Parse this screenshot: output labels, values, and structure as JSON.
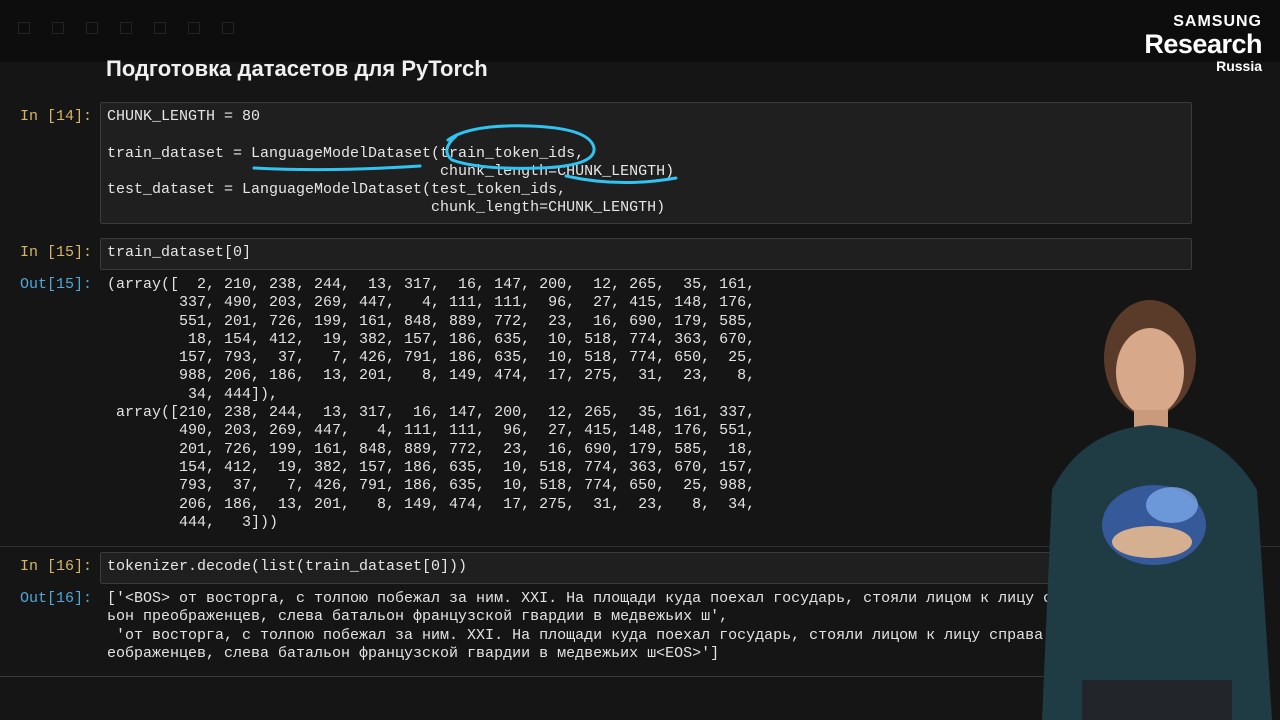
{
  "brand": {
    "line1": "SAMSUNG",
    "line2": "Research",
    "line3": "Russia"
  },
  "heading": "Подготовка датасетов для PyTorch",
  "cells": {
    "in14": {
      "prompt": "In [14]:",
      "code": "CHUNK_LENGTH = 80\n\ntrain_dataset = LanguageModelDataset(train_token_ids,\n                                     chunk_length=CHUNK_LENGTH)\ntest_dataset = LanguageModelDataset(test_token_ids,\n                                    chunk_length=CHUNK_LENGTH)"
    },
    "in15": {
      "prompt": "In [15]:",
      "code": "train_dataset[0]"
    },
    "out15": {
      "prompt": "Out[15]:",
      "text": "(array([  2, 210, 238, 244,  13, 317,  16, 147, 200,  12, 265,  35, 161,\n        337, 490, 203, 269, 447,   4, 111, 111,  96,  27, 415, 148, 176,\n        551, 201, 726, 199, 161, 848, 889, 772,  23,  16, 690, 179, 585,\n         18, 154, 412,  19, 382, 157, 186, 635,  10, 518, 774, 363, 670,\n        157, 793,  37,   7, 426, 791, 186, 635,  10, 518, 774, 650,  25,\n        988, 206, 186,  13, 201,   8, 149, 474,  17, 275,  31,  23,   8,\n         34, 444]),\n array([210, 238, 244,  13, 317,  16, 147, 200,  12, 265,  35, 161, 337,\n        490, 203, 269, 447,   4, 111, 111,  96,  27, 415, 148, 176, 551,\n        201, 726, 199, 161, 848, 889, 772,  23,  16, 690, 179, 585,  18,\n        154, 412,  19, 382, 157, 186, 635,  10, 518, 774, 363, 670, 157,\n        793,  37,   7, 426, 791, 186, 635,  10, 518, 774, 650,  25, 988,\n        206, 186,  13, 201,   8, 149, 474,  17, 275,  31,  23,   8,  34,\n        444,   3]))"
    },
    "in16": {
      "prompt": "In [16]:",
      "code": "tokenizer.decode(list(train_dataset[0]))"
    },
    "out16": {
      "prompt": "Out[16]:",
      "text": "['<BOS> от восторга, с толпою побежал за ним. XXI. На площади куда поехал государь, стояли лицом к лицу с\nьон преображенцев, слева батальон французской гвардии в медвежьих ш',\n 'от восторга, с толпою побежал за ним. XXI. На площади куда поехал государь, стояли лицом к лицу справа\nеображенцев, слева батальон французской гвардии в медвежьих ш<EOS>']"
    }
  },
  "colors": {
    "in_prompt": "#d6b66a",
    "out_prompt": "#4fa8d8",
    "annotation": "#2fc4f2"
  }
}
